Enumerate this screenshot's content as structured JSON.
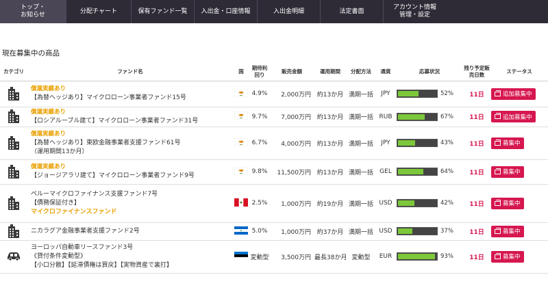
{
  "nav": [
    {
      "label": "トップ・",
      "label2": "お知らせ",
      "active": true
    },
    {
      "label": "分配チャート"
    },
    {
      "label": "保有ファンド一覧"
    },
    {
      "label": "入出金・口座情報"
    },
    {
      "label": "入出金明細"
    },
    {
      "label": "法定書面"
    },
    {
      "label": "アカウント情報",
      "label2": "管理・設定"
    }
  ],
  "section_title": "現在募集中の商品",
  "headers": {
    "category": "カテゴリ",
    "fund_name": "ファンド名",
    "country": "国",
    "expected_yield": "期待利回り",
    "amount": "販売金額",
    "period": "運用期間",
    "distribution": "分配方法",
    "currency": "通貨",
    "progress": "応募状況",
    "remaining_days": "残り予定販売日数",
    "status": "ステータス"
  },
  "rows": [
    {
      "icon": "building-icon",
      "tag": "償還実績あり",
      "name": "【為替ヘッジあり】マイクロローン事業者ファンド15号",
      "name2": "",
      "flag": "cyprus",
      "yield": "4.9%",
      "amount": "2,000万円",
      "period": "約13か月",
      "distribution": "満期一括",
      "currency": "JPY",
      "progress": 0.52,
      "progress_label": "52%",
      "days": "11日",
      "status": "追加募集中",
      "status_icon": "copy-icon"
    },
    {
      "icon": "building-icon",
      "tag": "償還実績あり",
      "name": "【ロシアルーブル建て】マイクロローン事業者ファンド31号",
      "name2": "",
      "flag": "cyprus",
      "yield": "9.7%",
      "amount": "7,000万円",
      "period": "約13か月",
      "distribution": "満期一括",
      "currency": "RUB",
      "progress": 0.67,
      "progress_label": "67%",
      "days": "11日",
      "status": "追加募集中",
      "status_icon": "copy-icon"
    },
    {
      "icon": "building-icon",
      "tag": "償還実績あり",
      "name": "【為替ヘッジあり】東欧金融事業者支援ファンド61号",
      "name2": "（運用期間13か月）",
      "flag": "cyprus",
      "yield": "6.7%",
      "amount": "4,000万円",
      "period": "約13か月",
      "distribution": "満期一括",
      "currency": "JPY",
      "progress": 0.43,
      "progress_label": "43%",
      "days": "11日",
      "status": "募集中",
      "status_icon": "copy-icon"
    },
    {
      "icon": "building-icon",
      "tag": "償還実績あり",
      "name": "【ジョージアラリ建て】マイクロローン事業者ファンド9号",
      "name2": "",
      "flag": "cyprus",
      "yield": "9.8%",
      "amount": "11,500万円",
      "period": "約13か月",
      "distribution": "満期一括",
      "currency": "GEL",
      "progress": 0.64,
      "progress_label": "64%",
      "days": "11日",
      "status": "募集中",
      "status_icon": "copy-icon"
    },
    {
      "icon": "building-icon",
      "tag": "",
      "name": "ペルーマイクロファイナンス支援ファンド7号",
      "name2": "【債務保証付き】",
      "tag_bottom": "マイクロファイナンスファンド",
      "flag": "peru",
      "yield": "2.5%",
      "amount": "1,000万円",
      "period": "約19か月",
      "distribution": "満期一括",
      "currency": "USD",
      "progress": 0.42,
      "progress_label": "42%",
      "days": "11日",
      "status": "募集中",
      "status_icon": "copy-icon"
    },
    {
      "icon": "building-icon",
      "tag": "",
      "name": "ニカラグア金融事業者支援ファンド2号",
      "name2": "",
      "flag": "nicaragua",
      "yield": "5.0%",
      "amount": "1,000万円",
      "period": "約37か月",
      "distribution": "満期一括",
      "currency": "USD",
      "progress": 0.37,
      "progress_label": "37%",
      "days": "11日",
      "status": "募集中",
      "status_icon": "copy-icon"
    },
    {
      "icon": "car-icon",
      "tag": "",
      "name": "ヨーロッパ自動車リースファンド3号",
      "name2": "《貸付条件変動型》",
      "name3": "【小口分散】【延滞債権は買戻】【実物資産で裏打】",
      "flag": "estonia",
      "yield": "変動型",
      "amount": "3,500万円",
      "period": "最長38か月",
      "distribution": "変動型",
      "currency": "EUR",
      "progress": 0.93,
      "progress_label": "93%",
      "days": "11日",
      "status": "募集中",
      "status_icon": "copy-icon"
    }
  ]
}
